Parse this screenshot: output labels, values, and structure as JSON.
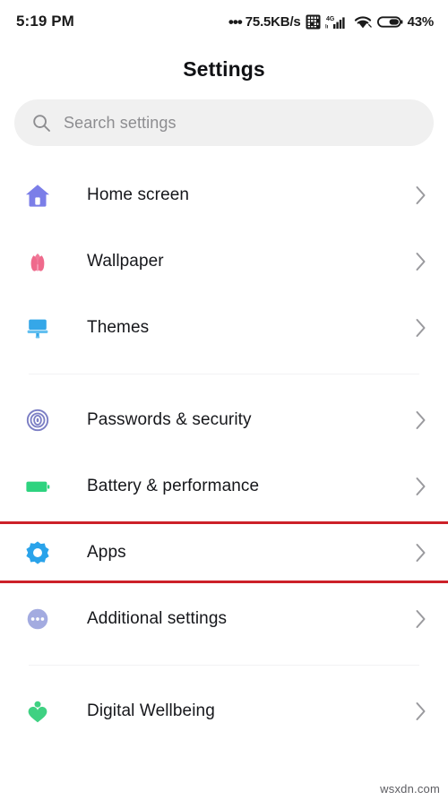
{
  "status_bar": {
    "time": "5:19 PM",
    "dots": "•••",
    "network_speed": "75.5KB/s",
    "vpn_icon": "vpn-key-icon",
    "mobile_label": "4G",
    "signal_icon": "signal-bars-icon",
    "wifi_icon": "wifi-icon",
    "battery_icon": "battery-icon",
    "battery_percent": "43%"
  },
  "header": {
    "title": "Settings"
  },
  "search": {
    "icon": "search-icon",
    "placeholder": "Search settings",
    "value": ""
  },
  "groups": [
    {
      "items": [
        {
          "label": "Home screen",
          "icon": "home-icon",
          "color": "#7b7ee8",
          "chevron": "chevron-right-icon"
        },
        {
          "label": "Wallpaper",
          "icon": "tulip-icon",
          "color": "#ef6a8c",
          "chevron": "chevron-right-icon"
        },
        {
          "label": "Themes",
          "icon": "paint-brush-icon",
          "color": "#35a7e8",
          "chevron": "chevron-right-icon"
        }
      ]
    },
    {
      "items": [
        {
          "label": "Passwords & security",
          "icon": "fingerprint-icon",
          "color": "#7b7ec4",
          "chevron": "chevron-right-icon"
        },
        {
          "label": "Battery & performance",
          "icon": "battery-icon",
          "color": "#2ed37f",
          "chevron": "chevron-right-icon"
        },
        {
          "label": "Apps",
          "icon": "gear-icon",
          "color": "#2aa3ea",
          "chevron": "chevron-right-icon",
          "highlighted": true
        },
        {
          "label": "Additional settings",
          "icon": "three-dots-circle-icon",
          "color": "#a3abe0",
          "chevron": "chevron-right-icon"
        }
      ]
    },
    {
      "items": [
        {
          "label": "Digital Wellbeing",
          "icon": "heart-person-icon",
          "color": "#3fd182",
          "chevron": "chevron-right-icon"
        }
      ]
    }
  ],
  "highlight": {
    "color": "#cc2128"
  },
  "watermark": {
    "text": "wsxdn.com"
  }
}
